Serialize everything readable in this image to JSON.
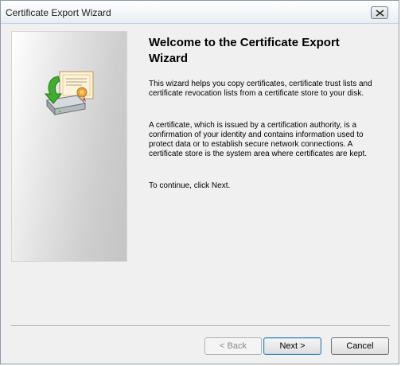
{
  "window": {
    "title": "Certificate Export Wizard",
    "close_icon": "close-icon"
  },
  "main": {
    "heading": "Welcome to the Certificate Export Wizard",
    "paragraphs": [
      "This wizard helps you copy certificates, certificate trust lists and certificate revocation lists from a certificate store to your disk.",
      "A certificate, which is issued by a certification authority, is a confirmation of your identity and contains information used to protect data or to establish secure network connections. A certificate store is the system area where certificates are kept.",
      "To continue, click Next."
    ],
    "illustration_icon": "certificate-export-icon"
  },
  "buttons": {
    "back": "< Back",
    "next": "Next >",
    "cancel": "Cancel"
  },
  "colors": {
    "window_bg": "#f0f0f0",
    "title_bar_top": "#ffffff",
    "title_bar_bottom": "#e8edf3"
  }
}
